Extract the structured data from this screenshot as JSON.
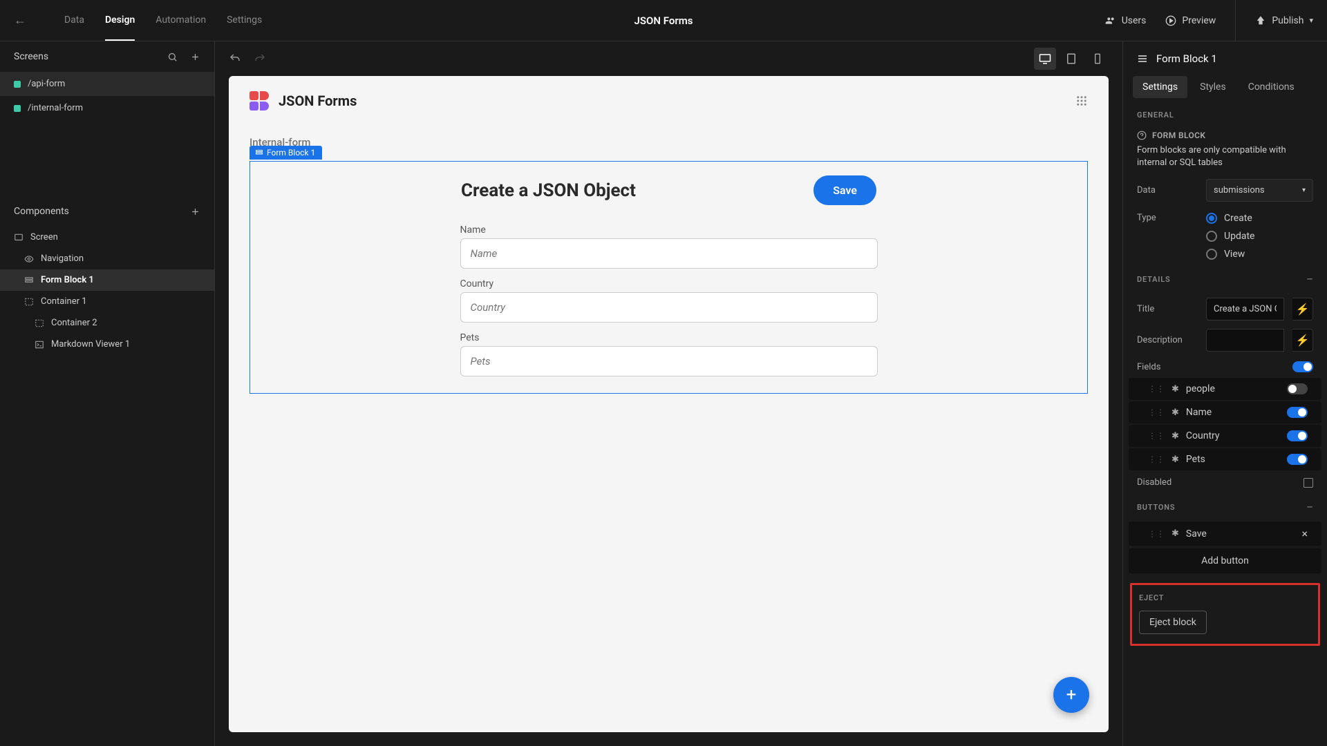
{
  "topbar": {
    "nav": {
      "data": "Data",
      "design": "Design",
      "automation": "Automation",
      "settings": "Settings"
    },
    "title": "JSON Forms",
    "actions": {
      "users": "Users",
      "preview": "Preview",
      "publish": "Publish"
    }
  },
  "sidebar": {
    "screens_header": "Screens",
    "screens": [
      "/api-form",
      "/internal-form"
    ],
    "components_header": "Components",
    "components": {
      "screen": "Screen",
      "nav": "Navigation",
      "formblock": "Form Block 1",
      "container1": "Container 1",
      "container2": "Container 2",
      "markdown": "Markdown Viewer 1"
    }
  },
  "canvas": {
    "app_title": "JSON Forms",
    "subheader": "Internal-form",
    "block_tag": "Form Block 1",
    "form_title": "Create a JSON Object",
    "save_label": "Save",
    "fields": {
      "name": {
        "label": "Name",
        "placeholder": "Name"
      },
      "country": {
        "label": "Country",
        "placeholder": "Country"
      },
      "pets": {
        "label": "Pets",
        "placeholder": "Pets"
      }
    }
  },
  "right": {
    "header": "Form Block 1",
    "tabs": {
      "settings": "Settings",
      "styles": "Styles",
      "conditions": "Conditions"
    },
    "general": {
      "title": "GENERAL",
      "info_title": "FORM BLOCK",
      "info_text": "Form blocks are only compatible with internal or SQL tables",
      "data_label": "Data",
      "data_value": "submissions",
      "type_label": "Type",
      "type_options": {
        "create": "Create",
        "update": "Update",
        "view": "View"
      }
    },
    "details": {
      "title": "DETAILS",
      "title_label": "Title",
      "title_value": "Create a JSON Obj...",
      "desc_label": "Description",
      "fields_label": "Fields",
      "field_list": [
        {
          "name": "people",
          "on": false
        },
        {
          "name": "Name",
          "on": true
        },
        {
          "name": "Country",
          "on": true
        },
        {
          "name": "Pets",
          "on": true
        }
      ],
      "disabled_label": "Disabled"
    },
    "buttons": {
      "title": "BUTTONS",
      "items": [
        "Save"
      ],
      "add_label": "Add button"
    },
    "eject": {
      "title": "EJECT",
      "button": "Eject block"
    }
  }
}
